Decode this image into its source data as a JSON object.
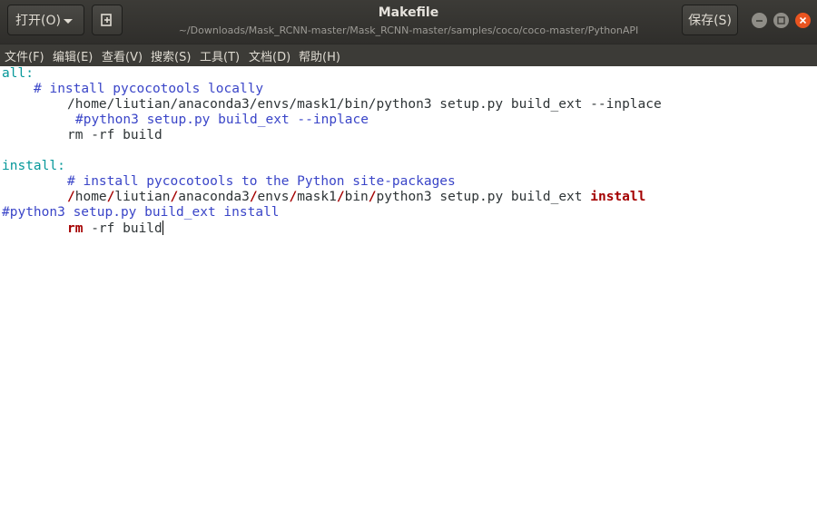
{
  "header": {
    "open_label": "打开(O)",
    "save_label": "保存(S)",
    "title": "Makefile",
    "path": "~/Downloads/Mask_RCNN-master/Mask_RCNN-master/samples/coco/coco-master/PythonAPI"
  },
  "menu": [
    "文件(F)",
    "编辑(E)",
    "查看(V)",
    "搜索(S)",
    "工具(T)",
    "文档(D)",
    "帮助(H)"
  ],
  "editor": {
    "lines": {
      "l1": "all:",
      "l2": "# install pycocotools locally",
      "l3": "/home/liutian/anaconda3/envs/mask1/bin/python3 setup.py build_ext --inplace",
      "l4": "#python3 setup.py build_ext --inplace",
      "l5": "rm -rf build",
      "l7": "install:",
      "l8": "# install pycocotools to the Python site-packages",
      "l9": {
        "p1": "/",
        "p2": "home",
        "p3": "/",
        "p4": "liutian",
        "p5": "/",
        "p6": "anaconda3",
        "p7": "/",
        "p8": "envs",
        "p9": "/",
        "p10": "mask1",
        "p11": "/",
        "p12": "bin",
        "p13": "/",
        "p14": "python3 setup.py build_ext ",
        "p15": "install"
      },
      "l10": "#python3 setup.py build_ext install",
      "l11": {
        "kw": "rm",
        "rest": " -rf build"
      }
    }
  },
  "icons": {
    "new_tab": "new-document-plus-icon",
    "dropdown": "chevron-down-icon"
  },
  "colors": {
    "close": "#e95420",
    "comment": "#3a45c8",
    "keyword": "#a40000",
    "label": "#06989a"
  }
}
